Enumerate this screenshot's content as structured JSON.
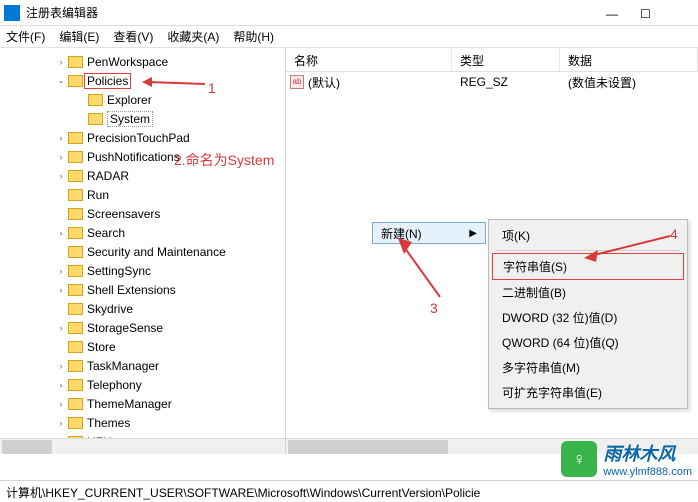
{
  "window": {
    "title": "注册表编辑器"
  },
  "menu": {
    "file": "文件(F)",
    "edit": "编辑(E)",
    "view": "查看(V)",
    "favorites": "收藏夹(A)",
    "help": "帮助(H)"
  },
  "tree": [
    {
      "indent": 56,
      "exp": ">",
      "label": "PenWorkspace"
    },
    {
      "indent": 56,
      "exp": "v",
      "label": "Policies",
      "red": true
    },
    {
      "indent": 76,
      "exp": "",
      "label": "Explorer"
    },
    {
      "indent": 76,
      "exp": "",
      "label": "System",
      "box": true
    },
    {
      "indent": 56,
      "exp": ">",
      "label": "PrecisionTouchPad"
    },
    {
      "indent": 56,
      "exp": ">",
      "label": "PushNotifications"
    },
    {
      "indent": 56,
      "exp": ">",
      "label": "RADAR"
    },
    {
      "indent": 56,
      "exp": "",
      "label": "Run"
    },
    {
      "indent": 56,
      "exp": "",
      "label": "Screensavers"
    },
    {
      "indent": 56,
      "exp": ">",
      "label": "Search"
    },
    {
      "indent": 56,
      "exp": "",
      "label": "Security and Maintenance"
    },
    {
      "indent": 56,
      "exp": ">",
      "label": "SettingSync"
    },
    {
      "indent": 56,
      "exp": ">",
      "label": "Shell Extensions"
    },
    {
      "indent": 56,
      "exp": "",
      "label": "Skydrive"
    },
    {
      "indent": 56,
      "exp": ">",
      "label": "StorageSense"
    },
    {
      "indent": 56,
      "exp": "",
      "label": "Store"
    },
    {
      "indent": 56,
      "exp": ">",
      "label": "TaskManager"
    },
    {
      "indent": 56,
      "exp": ">",
      "label": "Telephony"
    },
    {
      "indent": 56,
      "exp": ">",
      "label": "ThemeManager"
    },
    {
      "indent": 56,
      "exp": ">",
      "label": "Themes"
    },
    {
      "indent": 56,
      "exp": ">",
      "label": "UFH"
    }
  ],
  "columns": {
    "name": "名称",
    "type": "类型",
    "data": "数据"
  },
  "row": {
    "icon": "ab",
    "name": "(默认)",
    "type": "REG_SZ",
    "data": "(数值未设置)"
  },
  "context": {
    "new": "新建(N)",
    "items": [
      {
        "label": "项(K)"
      },
      {
        "sep": true
      },
      {
        "label": "字符串值(S)",
        "red": true
      },
      {
        "label": "二进制值(B)"
      },
      {
        "label": "DWORD (32 位)值(D)"
      },
      {
        "label": "QWORD (64 位)值(Q)"
      },
      {
        "label": "多字符串值(M)"
      },
      {
        "label": "可扩充字符串值(E)"
      }
    ]
  },
  "annotations": {
    "a1": "1",
    "a2": "2.命名为System",
    "a3": "3",
    "a4": "4"
  },
  "status": {
    "path": "计算机\\HKEY_CURRENT_USER\\SOFTWARE\\Microsoft\\Windows\\CurrentVersion\\Policie"
  },
  "watermark": {
    "top": "雨林木风",
    "bottom": "www.ylmf888.com",
    "badge": "♀"
  }
}
